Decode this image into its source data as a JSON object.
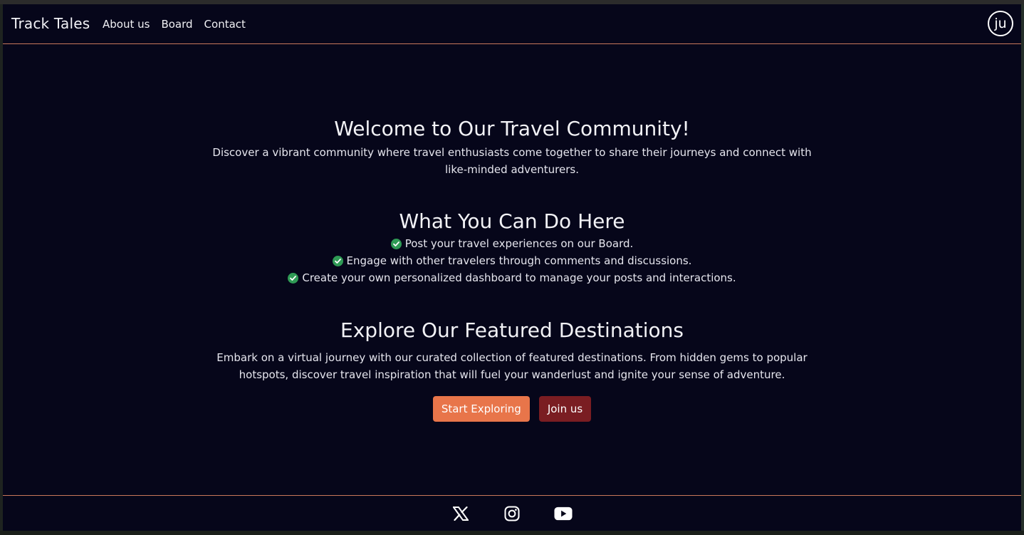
{
  "nav": {
    "brand": "Track Tales",
    "links": [
      "About us",
      "Board",
      "Contact"
    ],
    "avatar_initials": "ju"
  },
  "welcome": {
    "title": "Welcome to Our Travel Community!",
    "text": "Discover a vibrant community where travel enthusiasts come together to share their journeys and connect with like-minded adventurers."
  },
  "features": {
    "title": "What You Can Do Here",
    "items": [
      "Post your travel experiences on our Board.",
      "Engage with other travelers through comments and discussions.",
      "Create your own personalized dashboard to manage your posts and interactions."
    ]
  },
  "explore": {
    "title": "Explore Our Featured Destinations",
    "text": "Embark on a virtual journey with our curated collection of featured destinations. From hidden gems to popular hotspots, discover travel inspiration that will fuel your wanderlust and ignite your sense of adventure."
  },
  "buttons": {
    "primary": "Start Exploring",
    "secondary": "Join us"
  },
  "footer": {
    "icons": [
      "x-icon",
      "instagram-icon",
      "youtube-icon"
    ]
  },
  "colors": {
    "background": "#06061a",
    "accent_line": "#c8775a",
    "primary_button": "#e8754a",
    "secondary_button": "#7a1d22",
    "check": "#2f9a55"
  }
}
